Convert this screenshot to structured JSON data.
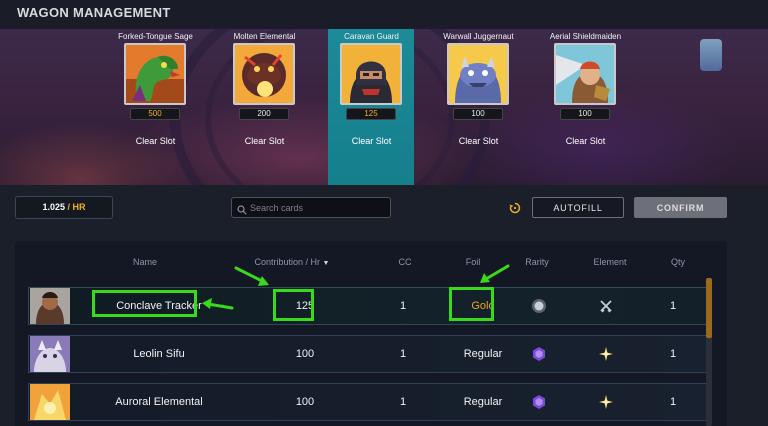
{
  "header": {
    "title": "WAGON MANAGEMENT"
  },
  "slots": [
    {
      "name": "Forked-Tongue Sage",
      "value": "500",
      "clear": "Clear Slot",
      "portrait": "green-serpent-sage"
    },
    {
      "name": "Molten Elemental",
      "value": "200",
      "clear": "Clear Slot",
      "portrait": "lava-elemental"
    },
    {
      "name": "Caravan Guard",
      "value": "125",
      "clear": "Clear Slot",
      "portrait": "masked-guard"
    },
    {
      "name": "Warwall Juggernaut",
      "value": "100",
      "clear": "Clear Slot",
      "portrait": "blue-juggernaut"
    },
    {
      "name": "Aerial Shieldmaiden",
      "value": "100",
      "clear": "Clear Slot",
      "portrait": "winged-shieldmaiden"
    }
  ],
  "controls": {
    "rate_value": "1.025",
    "rate_unit": "/ HR",
    "search_placeholder": "Search cards",
    "autofill_label": "AUTOFILL",
    "confirm_label": "CONFIRM"
  },
  "table": {
    "headers": {
      "name": "Name",
      "contribution": "Contribution / Hr",
      "cc": "CC",
      "foil": "Foil",
      "rarity": "Rarity",
      "element": "Element",
      "qty": "Qty"
    },
    "rows": [
      {
        "name": "Conclave Tracker",
        "contribution": "125",
        "cc": "1",
        "foil": "Gold",
        "rarity": "common-rarity-icon",
        "element": "neutral-element-icon",
        "qty": "1"
      },
      {
        "name": "Leolin Sifu",
        "contribution": "100",
        "cc": "1",
        "foil": "Regular",
        "rarity": "epic-rarity-icon",
        "element": "light-element-icon",
        "qty": "1"
      },
      {
        "name": "Auroral Elemental",
        "contribution": "100",
        "cc": "1",
        "foil": "Regular",
        "rarity": "epic-rarity-icon",
        "element": "light-element-icon",
        "qty": "1"
      }
    ]
  },
  "colors": {
    "accent_teal": "#1d8a98",
    "gold": "#f0b21e",
    "annotation_green": "#39d91c"
  }
}
